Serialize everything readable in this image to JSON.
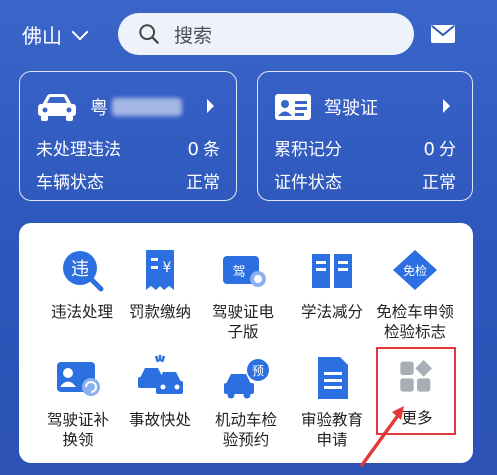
{
  "header": {
    "city": "佛山",
    "search_placeholder": "搜索"
  },
  "vehicle_card": {
    "plate_prefix": "粤",
    "violations_label": "未处理违法",
    "violations_count": "0",
    "violations_unit": "条",
    "status_label": "车辆状态",
    "status_value": "正常"
  },
  "license_card": {
    "title": "驾驶证",
    "points_label": "累积记分",
    "points_value": "0",
    "points_unit": "分",
    "status_label": "证件状态",
    "status_value": "正常"
  },
  "services": [
    {
      "label_1": "违法处理",
      "label_2": "",
      "icon": "violation-icon"
    },
    {
      "label_1": "罚款缴纳",
      "label_2": "",
      "icon": "fine-payment-icon"
    },
    {
      "label_1": "驾驶证电",
      "label_2": "子版",
      "icon": "e-license-icon"
    },
    {
      "label_1": "学法减分",
      "label_2": "",
      "icon": "study-book-icon"
    },
    {
      "label_1": "免检车申领",
      "label_2": "检验标志",
      "icon": "inspection-exempt-icon"
    },
    {
      "label_1": "驾驶证补",
      "label_2": "换领",
      "icon": "license-renew-icon"
    },
    {
      "label_1": "事故快处",
      "label_2": "",
      "icon": "accident-icon"
    },
    {
      "label_1": "机动车检",
      "label_2": "验预约",
      "icon": "inspection-booking-icon"
    },
    {
      "label_1": "审验教育",
      "label_2": "申请",
      "icon": "review-education-icon"
    },
    {
      "label_1": "更多",
      "label_2": "",
      "icon": "more-apps-icon"
    }
  ],
  "colors": {
    "brand_blue": "#2f58bd",
    "icon_blue": "#2c6fe0",
    "highlight_red": "#e23a3a"
  }
}
